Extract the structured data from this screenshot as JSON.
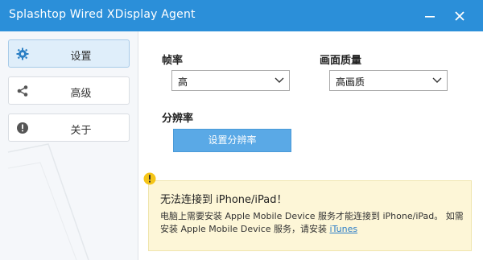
{
  "window": {
    "title": "Splashtop Wired XDisplay Agent",
    "accent": "#2b8fd9"
  },
  "sidebar": {
    "items": [
      {
        "label": "设置",
        "icon": "gear-icon",
        "active": true
      },
      {
        "label": "高级",
        "icon": "share-icon",
        "active": false
      },
      {
        "label": "关于",
        "icon": "info-icon",
        "active": false
      }
    ]
  },
  "settings": {
    "frame_rate": {
      "label": "帧率",
      "value": "高"
    },
    "quality": {
      "label": "画面质量",
      "value": "高画质"
    },
    "resolution": {
      "label": "分辨率",
      "button": "设置分辨率"
    }
  },
  "notice": {
    "title": "无法连接到 iPhone/iPad！",
    "body": "电脑上需要安装 Apple Mobile Device 服务才能连接到 iPhone/iPad。 如需安装 Apple Mobile Device 服务，请安装",
    "link": "iTunes"
  }
}
